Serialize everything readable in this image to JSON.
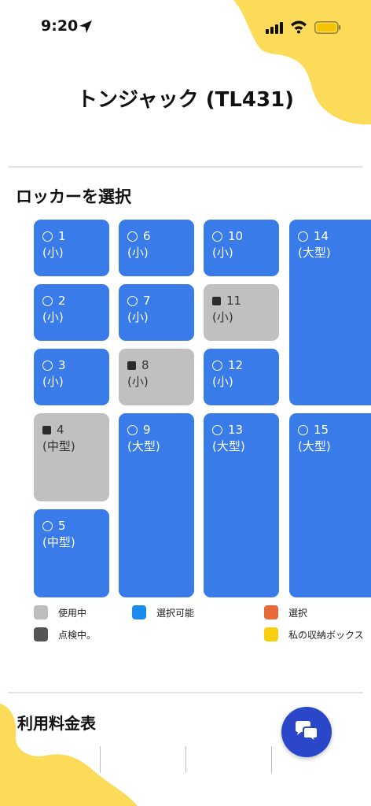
{
  "status_bar": {
    "time": "9:20"
  },
  "header": {
    "title": "トンジャック (TL431)"
  },
  "locker_section": {
    "title": "ロッカーを選択",
    "lockers": [
      {
        "number": "1",
        "size": "(小)",
        "status": "available"
      },
      {
        "number": "2",
        "size": "(小)",
        "status": "available"
      },
      {
        "number": "3",
        "size": "(小)",
        "status": "available"
      },
      {
        "number": "4",
        "size": "(中型)",
        "status": "in_use"
      },
      {
        "number": "5",
        "size": "(中型)",
        "status": "available"
      },
      {
        "number": "6",
        "size": "(小)",
        "status": "available"
      },
      {
        "number": "7",
        "size": "(小)",
        "status": "available"
      },
      {
        "number": "8",
        "size": "(小)",
        "status": "in_use"
      },
      {
        "number": "9",
        "size": "(大型)",
        "status": "available"
      },
      {
        "number": "10",
        "size": "(小)",
        "status": "available"
      },
      {
        "number": "11",
        "size": "(小)",
        "status": "in_use"
      },
      {
        "number": "12",
        "size": "(小)",
        "status": "available"
      },
      {
        "number": "13",
        "size": "(大型)",
        "status": "available"
      },
      {
        "number": "14",
        "size": "(大型)",
        "status": "available"
      },
      {
        "number": "15",
        "size": "(大型)",
        "status": "available"
      }
    ]
  },
  "legend": [
    {
      "label": "使用中",
      "color": "#bdbdbd"
    },
    {
      "label": "選択可能",
      "color": "#1a8cf0"
    },
    {
      "label": "選択",
      "color": "#e8693a"
    },
    {
      "label": "点検中。",
      "color": "#555555"
    },
    {
      "label": "私の収納ボックス",
      "color": "#f7cf10"
    }
  ],
  "fee_section": {
    "title": "利用料金表"
  },
  "colors": {
    "available": "#3a7bea",
    "in_use": "#c0c0c0",
    "accent_yellow": "#fbdb57",
    "chat_button": "#2b47c9"
  },
  "icons": [
    "location-arrow-icon",
    "signal-icon",
    "wifi-icon",
    "battery-icon",
    "chat-bubbles-icon"
  ]
}
